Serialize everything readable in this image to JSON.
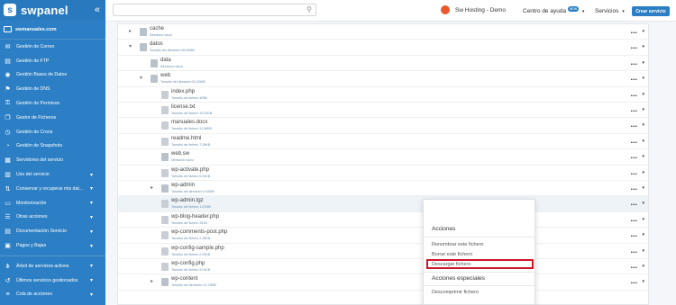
{
  "brand": {
    "name": "swpanel",
    "collapse_icon": "double-chevron-left"
  },
  "sidebar": {
    "account": "swmanuales.com",
    "items": [
      {
        "label": "Gestión de Correo",
        "icon": "envelope-icon",
        "chevron": false
      },
      {
        "label": "Gestión de FTP",
        "icon": "server-icon",
        "chevron": false
      },
      {
        "label": "Gestión Bases de Datos",
        "icon": "database-icon",
        "chevron": false
      },
      {
        "label": "Gestión de DNS",
        "icon": "flag-icon",
        "chevron": false
      },
      {
        "label": "Gestión de Permisos",
        "icon": "permissions-icon",
        "chevron": false
      },
      {
        "label": "Gestor de Ficheros",
        "icon": "files-icon",
        "chevron": false
      },
      {
        "label": "Gestión de Crons",
        "icon": "clock-icon",
        "chevron": false
      },
      {
        "label": "Gestión de Snapshots",
        "icon": "snapshot-icon",
        "chevron": false
      },
      {
        "label": "Servidores del servicio",
        "icon": "servers-icon",
        "chevron": false
      },
      {
        "label": "Uso del servicio",
        "icon": "chart-icon",
        "chevron": true
      },
      {
        "label": "Conservar y recuperar mis dat...",
        "icon": "backup-icon",
        "chevron": true
      },
      {
        "label": "Monitorización",
        "icon": "monitor-icon",
        "chevron": true
      },
      {
        "label": "Otras acciones",
        "icon": "actions-icon",
        "chevron": true
      },
      {
        "label": "Documentación Servicio",
        "icon": "document-icon",
        "chevron": true
      },
      {
        "label": "Pagos y Bajas",
        "icon": "payment-icon",
        "chevron": true
      }
    ],
    "bottom_items": [
      {
        "label": "Árbol de servicios activos",
        "icon": "tree-icon",
        "chevron": true
      },
      {
        "label": "Últimos servicios gestionados",
        "icon": "history-icon",
        "chevron": true
      },
      {
        "label": "Cola de acciones",
        "icon": "queue-icon",
        "chevron": true
      }
    ]
  },
  "topbar": {
    "search_placeholder": "",
    "user": "Sw Hosting - Demo",
    "help": "Centro de ayuda",
    "help_badge": "NEW",
    "services": "Servicios",
    "create_button": "Crear servicio"
  },
  "rows": [
    {
      "name": "cache",
      "sub": "Directorio vacío",
      "type": "folder",
      "expander": "▸"
    },
    {
      "name": "datos",
      "sub": "Tamaño del directorio 99.00MB",
      "type": "folder",
      "expander": "▾"
    },
    {
      "name": "data",
      "sub": "Directorio vacío",
      "type": "folder",
      "expander": ""
    },
    {
      "name": "web",
      "sub": "Tamaño del directorio 81.00MB",
      "type": "folder",
      "expander": "▾"
    },
    {
      "name": "index.php",
      "sub": "Tamaño del fichero 405B",
      "type": "file",
      "expander": ""
    },
    {
      "name": "license.txt",
      "sub": "Tamaño del fichero 19.92KB",
      "type": "file",
      "expander": ""
    },
    {
      "name": "manuales.docx",
      "sub": "Tamaño del fichero 11.58KB",
      "type": "file",
      "expander": ""
    },
    {
      "name": "readme.html",
      "sub": "Tamaño del fichero 7.28KB",
      "type": "file",
      "expander": ""
    },
    {
      "name": "web.sw",
      "sub": "Directorio vacío",
      "type": "folder",
      "expander": ""
    },
    {
      "name": "wp-activate.php",
      "sub": "Tamaño del fichero 6.91KB",
      "type": "file",
      "expander": ""
    },
    {
      "name": "wp-admin",
      "sub": "Tamaño del directorio 9.54MB",
      "type": "folder",
      "expander": "▸"
    },
    {
      "name": "wp-admin.tgz",
      "sub": "Tamaño del fichero 1.67MB",
      "type": "file",
      "expander": ""
    },
    {
      "name": "wp-blog-header.php",
      "sub": "Tamaño del fichero 351B",
      "type": "file",
      "expander": ""
    },
    {
      "name": "wp-comments-post.php",
      "sub": "Tamaño del fichero 2.28KB",
      "type": "file",
      "expander": ""
    },
    {
      "name": "wp-config-sample.php",
      "sub": "Tamaño del fichero 2.93KB",
      "type": "file",
      "expander": ""
    },
    {
      "name": "wp-config.php",
      "sub": "Tamaño del fichero 3.01KB",
      "type": "file",
      "expander": ""
    },
    {
      "name": "wp-content",
      "sub": "Tamaño del directorio 31.73MB",
      "type": "folder",
      "expander": "▸"
    }
  ],
  "dropdown": {
    "header_actions": "Acciones",
    "actions": [
      "Renombrar este fichero",
      "Borrar este fichero",
      "Descargar fichero"
    ],
    "header_special": "Acciones especiales",
    "special_actions": [
      "Descomprimir fichero"
    ],
    "highlight_color": "#d0142c"
  },
  "colors": {
    "sidebar": "#2c7fc4",
    "accent": "#2c7fc4",
    "avatar": "#e8592b"
  }
}
